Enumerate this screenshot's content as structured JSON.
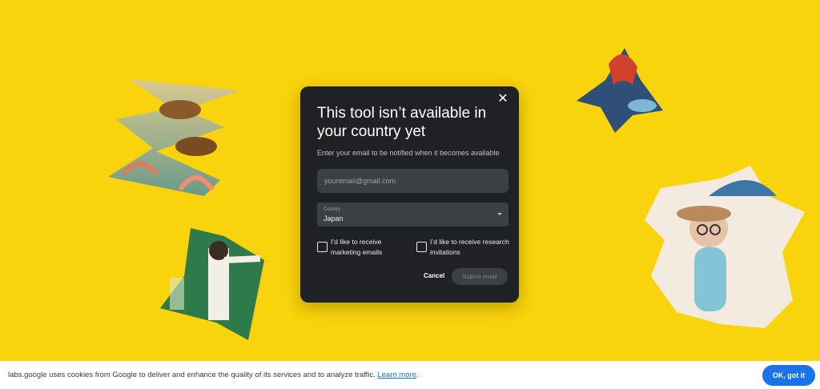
{
  "modal": {
    "title": "This tool isn’t available in your country yet",
    "subtitle": "Enter your email to be notified when it becomes available",
    "email_placeholder": "youremail@gmail.com",
    "country_label": "Country",
    "country_value": "Japan",
    "checkbox_marketing": "I’d like to receive marketing emails",
    "checkbox_research": "I’d like to receive research invitations",
    "cancel_label": "Cancel",
    "submit_label": "Submit email",
    "close_icon": "close-icon"
  },
  "cookie_bar": {
    "message": "labs.google uses cookies from Google to deliver and enhance the quality of its services and to analyze traffic.",
    "link_label": "Learn more",
    "period": ".",
    "ok_label": "OK, got it"
  },
  "colors": {
    "background": "#f9d30b",
    "modal": "#202124",
    "accent": "#1a73e8"
  }
}
